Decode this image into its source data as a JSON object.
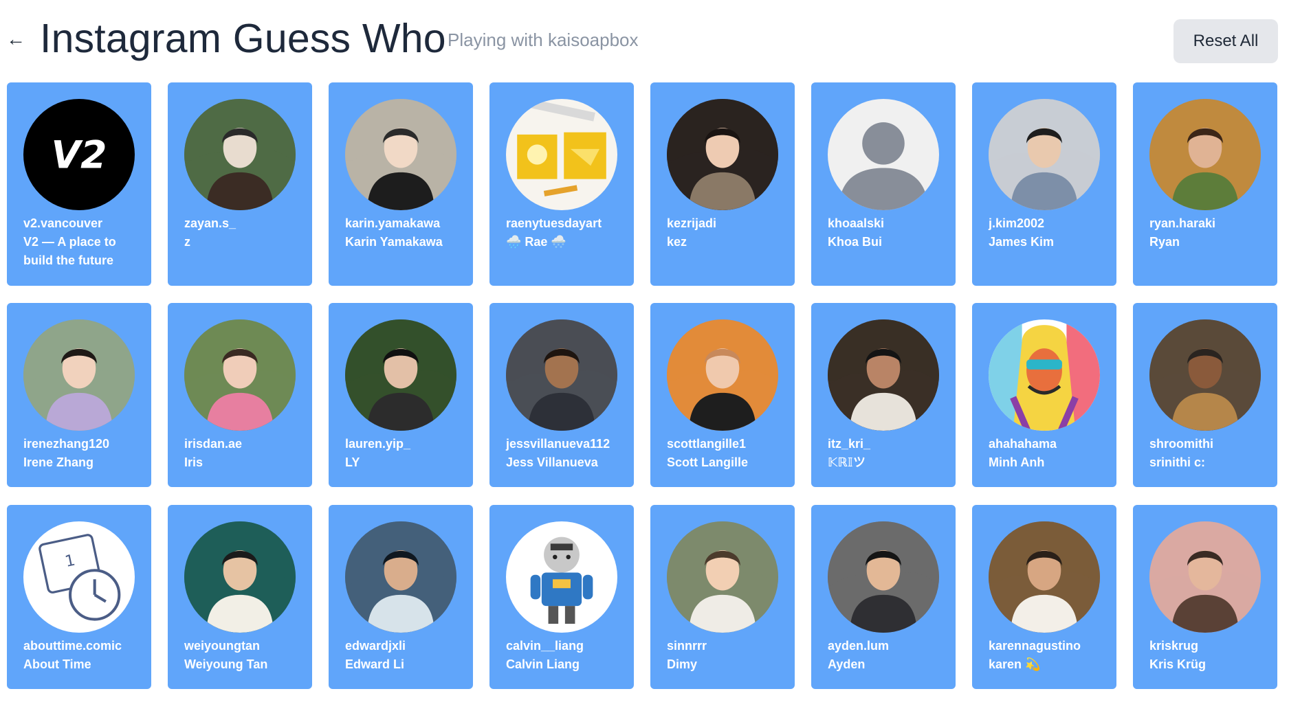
{
  "header": {
    "back_icon": "arrow-left-icon",
    "back_glyph": "←",
    "title": "Instagram Guess Who",
    "subtitle": "Playing with kaisoapbox",
    "reset_label": "Reset All"
  },
  "colors": {
    "card_bg": "#60a5fa",
    "title": "#1e293b",
    "subtitle": "#8a94a3",
    "button_bg": "#e5e7eb"
  },
  "cards": [
    {
      "username": "v2.vancouver",
      "name": "V2 — A place to build the future",
      "name_lines": [
        "V2 — A place to",
        "build the future"
      ],
      "avatar": "v2-logo"
    },
    {
      "username": "zayan.s_",
      "name": "z",
      "avatar": "photo-man-mountains"
    },
    {
      "username": "karin.yamakawa",
      "name": "Karin Yamakawa",
      "avatar": "photo-woman-cap"
    },
    {
      "username": "raenytuesdayart",
      "name": "🌧️ Rae 🌨️",
      "avatar": "yellow-art"
    },
    {
      "username": "kezrijadi",
      "name": "kez",
      "avatar": "photo-woman-smiling"
    },
    {
      "username": "khoaalski",
      "name": "Khoa Bui",
      "avatar": "default-user"
    },
    {
      "username": "j.kim2002",
      "name": "James Kim",
      "avatar": "photo-presenter"
    },
    {
      "username": "ryan.haraki",
      "name": "Ryan",
      "avatar": "photo-curly-hair"
    },
    {
      "username": "irenezhang120",
      "name": "Irene Zhang",
      "avatar": "photo-graduate"
    },
    {
      "username": "irisdan.ae",
      "name": "Iris",
      "avatar": "photo-pink-sweater"
    },
    {
      "username": "lauren.yip_",
      "name": "LY",
      "avatar": "photo-plants"
    },
    {
      "username": "jessvillanueva112",
      "name": "Jess Villanueva",
      "avatar": "photo-glasses"
    },
    {
      "username": "scottlangille1",
      "name": "Scott Langille",
      "avatar": "photo-sunset-man"
    },
    {
      "username": "itz_kri_",
      "name": "𝕂ℝ𝕀ツ",
      "avatar": "photo-vest"
    },
    {
      "username": "ahahahama",
      "name": "Minh Anh",
      "avatar": "pop-art-portrait"
    },
    {
      "username": "shroomithi",
      "name": "srinithi c:",
      "avatar": "photo-curly-woman"
    },
    {
      "username": "abouttime.comic",
      "name": "About Time",
      "avatar": "calendar-clock-drawing"
    },
    {
      "username": "weiyoungtan",
      "name": "Weiyoung Tan",
      "avatar": "photo-lake"
    },
    {
      "username": "edwardjxli",
      "name": "Edward Li",
      "avatar": "photo-surfing"
    },
    {
      "username": "calvin__liang",
      "name": "Calvin Liang",
      "avatar": "android-figure"
    },
    {
      "username": "sinnrrr",
      "name": "Dimy",
      "avatar": "photo-town"
    },
    {
      "username": "ayden.lum",
      "name": "Ayden",
      "avatar": "photo-cap-selfie"
    },
    {
      "username": "karennagustino",
      "name": "karen 💫",
      "avatar": "photo-hut"
    },
    {
      "username": "kriskrug",
      "name": "Kris Krüg",
      "avatar": "photo-bearded-man"
    }
  ]
}
